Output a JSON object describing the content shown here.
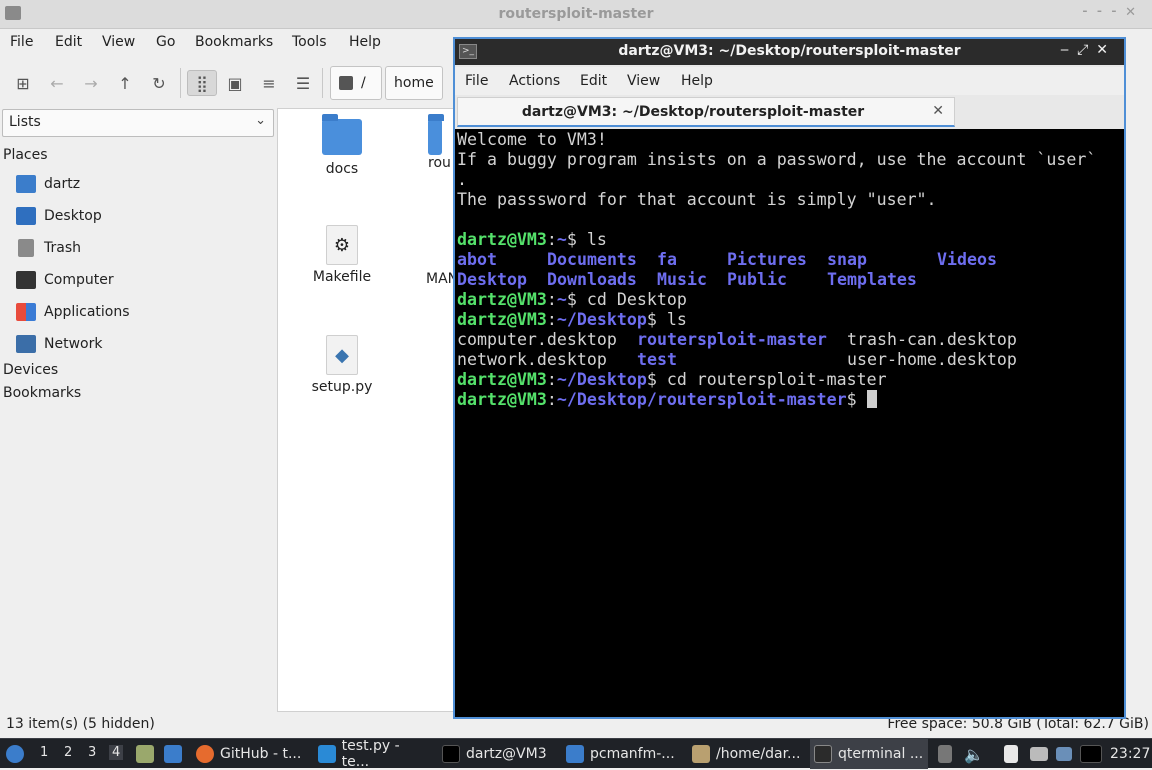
{
  "file_manager": {
    "title": "routersploit-master",
    "menu": [
      "File",
      "Edit",
      "View",
      "Go",
      "Bookmarks",
      "Tools",
      "Help"
    ],
    "path_buttons": [
      "/",
      "home"
    ],
    "sidebar_select": "Lists",
    "sidebar": {
      "places_label": "Places",
      "places": [
        {
          "label": "dartz",
          "icon": "home-folder-icon"
        },
        {
          "label": "Desktop",
          "icon": "desktop-icon"
        },
        {
          "label": "Trash",
          "icon": "trash-icon"
        },
        {
          "label": "Computer",
          "icon": "computer-icon"
        },
        {
          "label": "Applications",
          "icon": "applications-icon"
        },
        {
          "label": "Network",
          "icon": "network-icon"
        }
      ],
      "devices_label": "Devices",
      "bookmarks_label": "Bookmarks"
    },
    "files": [
      {
        "name": "docs",
        "icon": "folder-icon"
      },
      {
        "name": "rou",
        "icon": "folder-icon"
      },
      {
        "name": "Makefile",
        "icon": "makefile-icon"
      },
      {
        "name": "MAN",
        "icon": "document-icon"
      },
      {
        "name": "setup.py",
        "icon": "python-file-icon"
      }
    ],
    "status_left": "13 item(s) (5 hidden)",
    "status_right": "Free space: 50.8 GiB (Total: 62.7 GiB)"
  },
  "terminal": {
    "title": "dartz@VM3: ~/Desktop/routersploit-master",
    "menu": [
      "File",
      "Actions",
      "Edit",
      "View",
      "Help"
    ],
    "tab_label": "dartz@VM3: ~/Desktop/routersploit-master",
    "lines": {
      "l1": "Welcome to VM3!",
      "l2": "If a buggy program insists on a password, use the account `user`",
      "l3": ".",
      "l4": "The passsword for that account is simply \"user\".",
      "prompt_user": "dartz@VM3",
      "p1_path": "~",
      "p1_cmd": "$ ls",
      "ls1": {
        "a": "abot",
        "b": "Documents",
        "c": "fa",
        "d": "Pictures",
        "e": "snap",
        "f": "Videos"
      },
      "ls2": {
        "a": "Desktop",
        "b": "Downloads",
        "c": "Music",
        "d": "Public",
        "e": "Templates"
      },
      "p2_path": "~",
      "p2_cmd": "$ cd Desktop",
      "p3_path": "~/Desktop",
      "p3_cmd": "$ ls",
      "ls3": {
        "a": "computer.desktop",
        "b": "routersploit-master",
        "c": "trash-can.desktop"
      },
      "ls4": {
        "a": "network.desktop",
        "b": "test",
        "c": "user-home.desktop"
      },
      "p4_path": "~/Desktop",
      "p4_cmd": "$ cd routersploit-master",
      "p5_path": "~/Desktop/routersploit-master",
      "p5_cmd": "$ "
    }
  },
  "taskbar": {
    "workspaces": [
      "1",
      "2",
      "3",
      "4"
    ],
    "tasks": [
      {
        "label": "GitHub - t...",
        "icon": "firefox-icon"
      },
      {
        "label": "test.py - te...",
        "icon": "vscode-icon"
      },
      {
        "label": "dartz@VM3",
        "icon": "terminal-icon"
      },
      {
        "label": "pcmanfm-...",
        "icon": "folder-icon"
      },
      {
        "label": "/home/dar...",
        "icon": "archive-icon"
      },
      {
        "label": "qterminal ...",
        "icon": "terminal-icon"
      }
    ],
    "clock": "23:27"
  }
}
